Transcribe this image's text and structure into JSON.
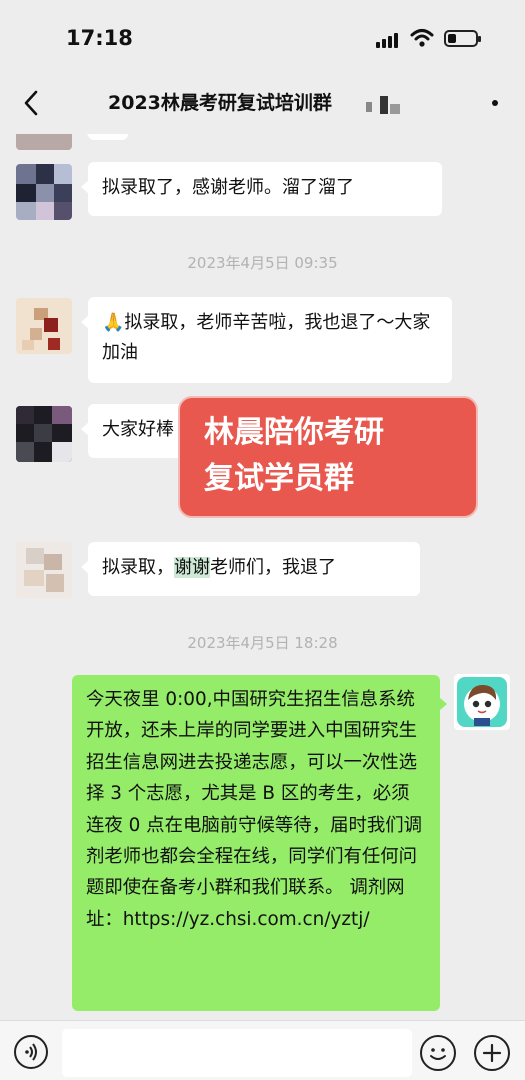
{
  "status_bar": {
    "time": "17:18"
  },
  "header": {
    "title": "2023林晨考研复试培训群"
  },
  "messages": [
    {
      "text": "拟录取了，感谢老师。溜了溜了"
    },
    {
      "text_after_emoji": "拟录取，老师辛苦啦，我也退了～大家加油",
      "emoji": "🙏"
    },
    {
      "text": "大家好棒"
    },
    {
      "text_before": "拟录取，",
      "highlight": "谢谢",
      "text_after": "老师们，我退了"
    },
    {
      "text": "今天夜里 0:00,中国研究生招生信息系统开放，还未上岸的同学要进入中国研究生招生信息网进去投递志愿，可以一次性选择 3 个志愿，尤其是 B 区的考生，必须连夜 0 点在电脑前守候等待，届时我们调剂老师也都会全程在线，同学们有任何问题即使在备考小群和我们联系。 调剂网址：https://yz.chsi.com.cn/yztj/"
    }
  ],
  "timestamps": [
    "2023年4月5日 09:35",
    "2023年4月5日 18:28"
  ],
  "overlay": {
    "line1": "林晨陪你考研",
    "line2": "复试学员群"
  },
  "icons": {
    "back": "chevron-left-icon",
    "more": "more-icon",
    "voice": "voice-icon",
    "emoji": "emoji-icon",
    "plus": "plus-icon"
  },
  "colors": {
    "background": "#ededed",
    "own_bubble": "#95ec69",
    "overlay": "#e8584f"
  }
}
